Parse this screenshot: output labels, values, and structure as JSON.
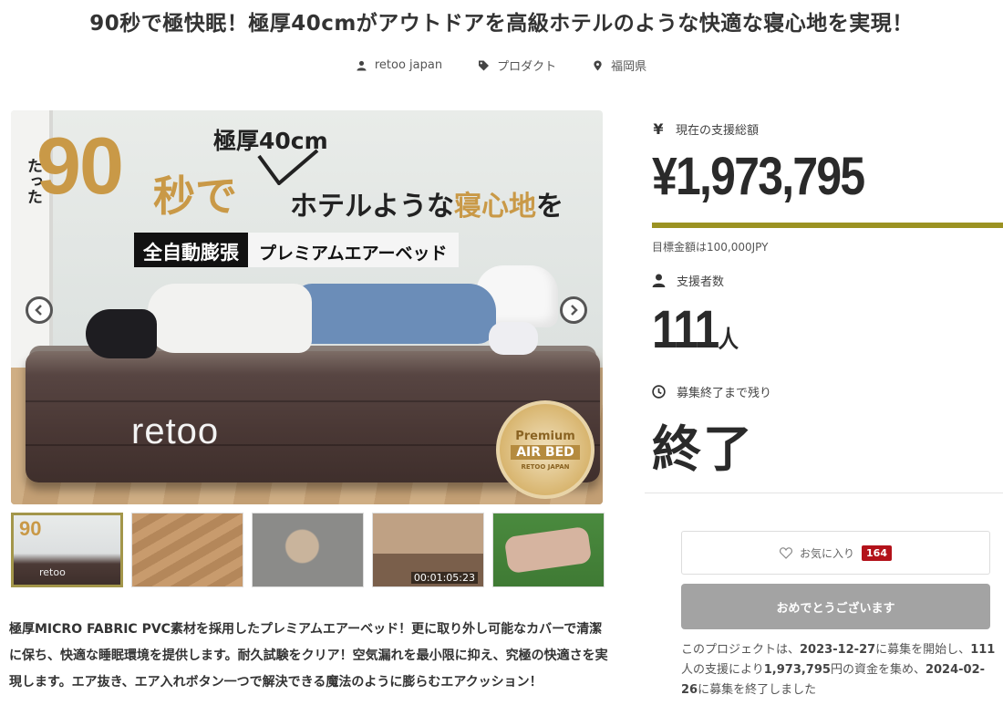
{
  "project": {
    "title": "90秒で極快眠！極厚40cmがアウトドアを高級ホテルのような快適な寝心地を実現！",
    "owner": "retoo japan",
    "category": "プロダクト",
    "location": "福岡県"
  },
  "hero": {
    "tatta": "たった",
    "big_number": "90",
    "byou_de": "秒で",
    "thickness": "極厚40cm",
    "headline_pre": "ホテルような",
    "headline_gold": "寝心地",
    "headline_post": "を",
    "banner_dark": "全自動膨張",
    "banner_light": "プレミアムエアーベッド",
    "brand": "retoo",
    "badge_line1": "Premium",
    "badge_line2": "AIR BED",
    "badge_line3": "RETOO JAPAN"
  },
  "thumbnails": [
    {
      "kind": "image",
      "big_number": "90",
      "brand": "retoo"
    },
    {
      "kind": "image"
    },
    {
      "kind": "image"
    },
    {
      "kind": "video",
      "time": "00:01:05:23"
    },
    {
      "kind": "image"
    }
  ],
  "description": "極厚MICRO FABRIC PVC素材を採用したプレミアムエアーベッド！更に取り外し可能なカバーで清潔に保ち、快適な睡眠環境を提供します。耐久試験をクリア！空気漏れを最小限に抑え、究極の快適さを実現します。エア抜き、エア入れボタン一つで解決できる魔法のように膨らむエアクッション！",
  "stats": {
    "yen_icon": "¥",
    "funding_label": "現在の支援総額",
    "funding_amount": "¥1,973,795",
    "progress_fraction": 1.0,
    "goal_text": "目標金額は100,000JPY",
    "backers_label": "支援者数",
    "backers_count": "111",
    "backers_unit": "人",
    "remaining_label": "募集終了まで残り",
    "remaining_value": "終了"
  },
  "actions": {
    "favorite_label": "お気に入り",
    "favorite_count": "164",
    "congrats_label": "おめでとうございます"
  },
  "summary": {
    "p1": "このプロジェクトは、",
    "start_date": "2023-12-27",
    "p2": "に募集を開始し、",
    "backers": "111",
    "p3": "人の支援により",
    "amount": "1,973,795",
    "p4": "円の資金を集め、",
    "end_date": "2024-02-26",
    "p5": "に募集を終了しました"
  },
  "colors": {
    "progress": "#9b9222",
    "favorite_badge": "#b3121a",
    "gold_text": "#c99947",
    "active_thumb_border": "#a3964a"
  }
}
